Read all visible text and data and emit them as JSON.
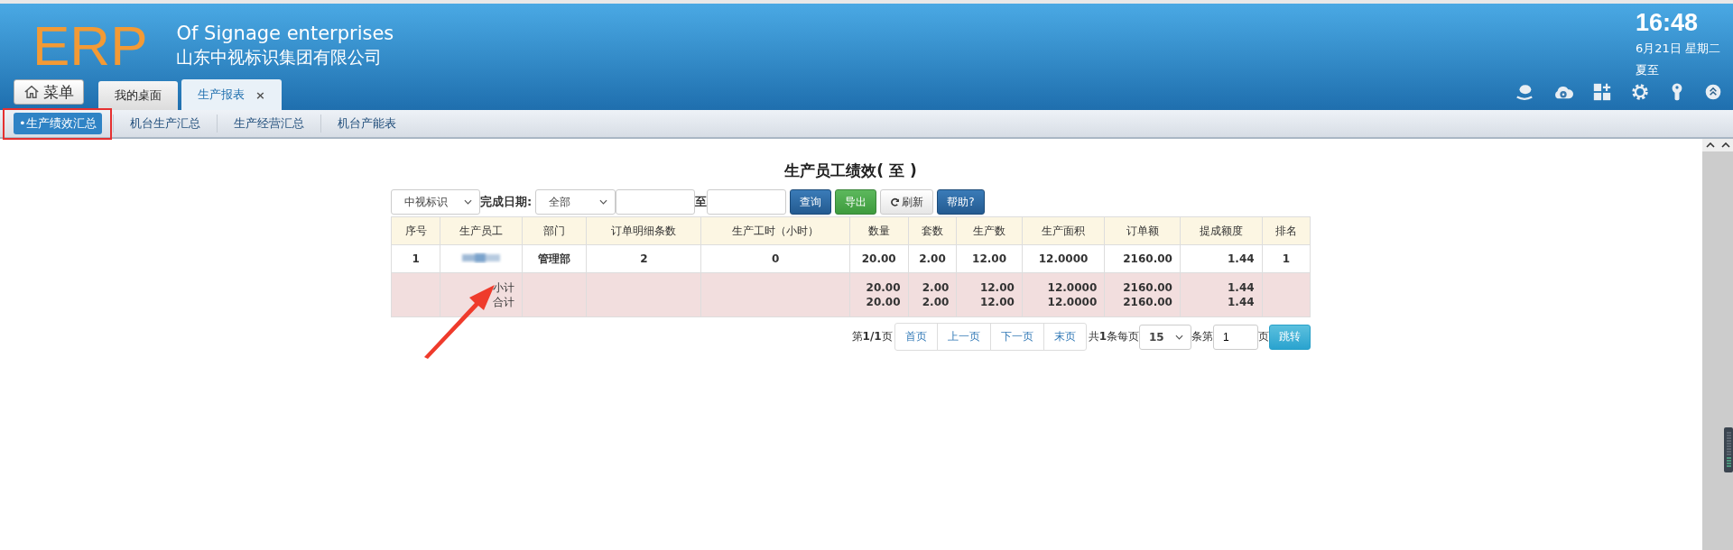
{
  "header": {
    "logo": "ERP",
    "subtitle_en": "Of Signage enterprises",
    "subtitle_cn": "山东中视标识集团有限公司",
    "menu_button": "菜单",
    "tabs": [
      {
        "label": "我的桌面",
        "selected": false
      },
      {
        "label": "生产报表",
        "selected": true,
        "close": "×"
      }
    ],
    "clock": {
      "time": "16:48",
      "date": "6月21日 星期二",
      "solar_term": "夏至"
    }
  },
  "subnav": [
    {
      "label": "•生产绩效汇总",
      "selected": true
    },
    {
      "label": "机台生产汇总",
      "selected": false
    },
    {
      "label": "生产经营汇总",
      "selected": false
    },
    {
      "label": "机台产能表",
      "selected": false
    }
  ],
  "report": {
    "title": "生产员工绩效( 至 )",
    "filters": {
      "company": "中视标识",
      "date_label": "完成日期:",
      "range": "全部",
      "to_label": "至"
    },
    "buttons": [
      {
        "label": "查询",
        "kind": "primary"
      },
      {
        "label": "导出",
        "kind": "success"
      },
      {
        "label": "刷新",
        "kind": "refresh"
      },
      {
        "label": "帮助?",
        "kind": "primary"
      }
    ],
    "table": {
      "columns": [
        "序号",
        "生产员工",
        "部门",
        "订单明细条数",
        "生产工时（小时）",
        "数量",
        "套数",
        "生产数",
        "生产面积",
        "订单额",
        "提成额度",
        "排名"
      ],
      "rows": [
        {
          "cells": [
            "1",
            {
              "kind": "blurred"
            },
            "管理部",
            "2",
            "0",
            "20.00",
            "2.00",
            "12.00",
            "12.0000",
            "2160.00",
            "1.44",
            "1"
          ]
        }
      ],
      "totals": [
        {
          "label": "小计",
          "values": [
            "20.00",
            "2.00",
            "12.00",
            "12.0000",
            "2160.00",
            "1.44"
          ]
        },
        {
          "label": "合计",
          "values": [
            "20.00",
            "2.00",
            "12.00",
            "12.0000",
            "2160.00",
            "1.44"
          ]
        }
      ]
    },
    "pager": {
      "page_info": "第**1/1**页",
      "nav": [
        "首页",
        "上一页",
        "下一页",
        "末页"
      ],
      "count": "共**1**条每页",
      "per_page": "15",
      "items_label": "条第",
      "page": "1",
      "page_label": "页",
      "go": "跳转"
    }
  }
}
